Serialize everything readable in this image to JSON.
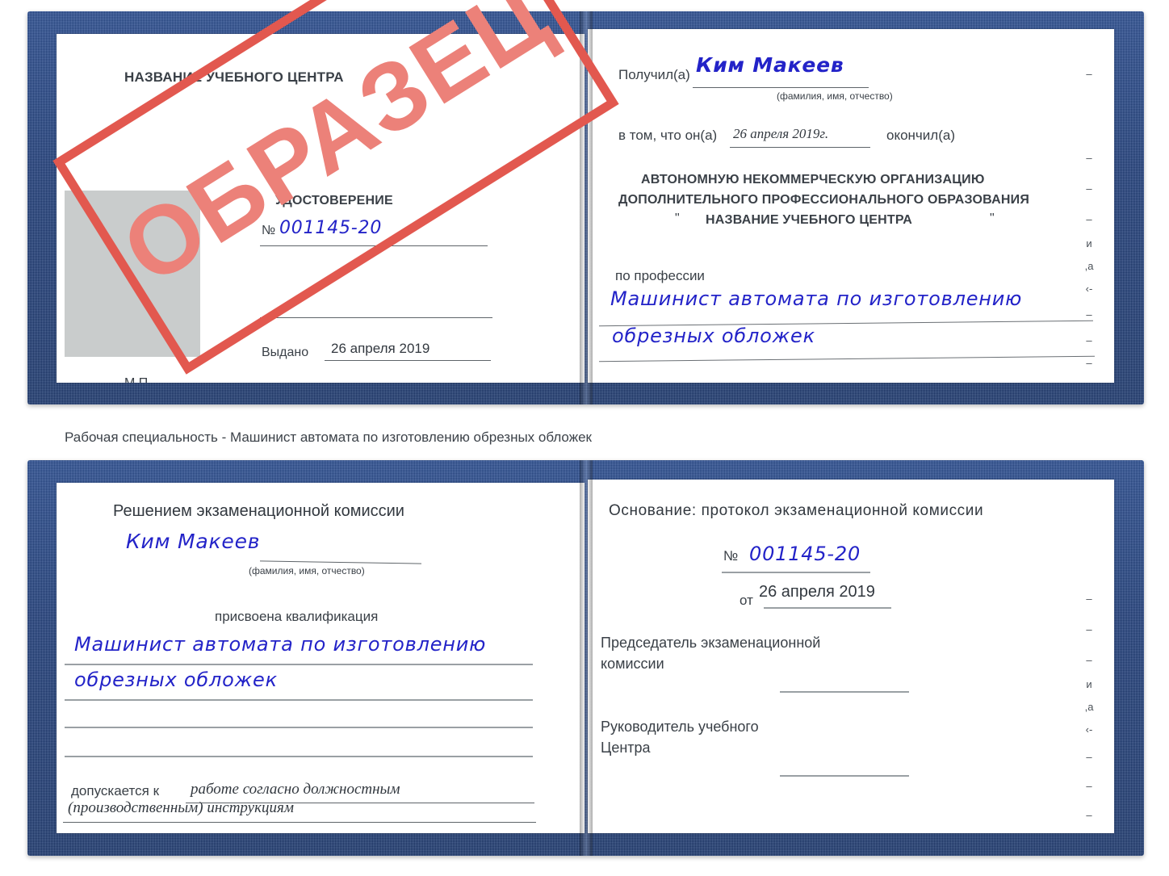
{
  "caption": "Рабочая специальность - Машинист автомата по изготовлению обрезных обложек",
  "stamp": {
    "text": "ОБРАЗЕЦ",
    "color": "#e2584f"
  },
  "colors": {
    "cover_blue": "#21407e",
    "handwriting_blue": "#2323c8",
    "stamp_red": "#e2584f",
    "photo_gray": "#c9cccc",
    "page_white": "#ffffff",
    "rule_gray": "#6a6f74"
  },
  "doc_top": {
    "left_page": {
      "center_name": "НАЗВАНИЕ УЧЕБНОГО ЦЕНТРА",
      "title": "УДОСТОВЕРЕНИЕ",
      "number_label": "№",
      "number_value": "001145-20",
      "issued_label": "Выдано",
      "issued_value": "26 апреля 2019",
      "seal_label": "М.П.",
      "photo_placeholder": ""
    },
    "right_page": {
      "received_label": "Получил(а)",
      "received_value": "Ким Макеев",
      "fio_hint": "(фамилия, имя, отчество)",
      "that_he_label": "в том, что он(а)",
      "that_he_value": "26 апреля 2019г.",
      "finished_label": "окончил(а)",
      "org_line1": "АВТОНОМНУЮ НЕКОММЕРЧЕСКУЮ ОРГАНИЗАЦИЮ",
      "org_line2": "ДОПОЛНИТЕЛЬНОГО ПРОФЕССИОНАЛЬНОГО ОБРАЗОВАНИЯ",
      "org_quote_open": "\"",
      "org_line3": "НАЗВАНИЕ УЧЕБНОГО ЦЕНТРА",
      "org_quote_close": "\"",
      "profession_label": "по профессии",
      "profession_line1": "Машинист автомата по изготовлению",
      "profession_line2": "обрезных обложек",
      "edge_fragments": [
        "–",
        "–",
        "–",
        "–",
        "и",
        "а",
        "‹-",
        "–",
        "–",
        "–",
        "–"
      ]
    }
  },
  "doc_bottom": {
    "left_page": {
      "decision_title": "Решением экзаменационной комиссии",
      "name_value": "Ким Макеев",
      "fio_hint": "(фамилия, имя, отчество)",
      "qualification_label": "присвоена квалификация",
      "qualification_line1": "Машинист автомата по изготовлению",
      "qualification_line2": "обрезных обложек",
      "admitted_label": "допускается к",
      "admitted_value_line1": "работе согласно должностным",
      "admitted_value_line2": "(производственным) инструкциям"
    },
    "right_page": {
      "basis_label": "Основание: протокол экзаменационной комиссии",
      "number_label": "№",
      "number_value": "001145-20",
      "date_label": "от",
      "date_value": "26 апреля 2019",
      "chairman_line1": "Председатель экзаменационной",
      "chairman_line2": "комиссии",
      "head_line1": "Руководитель учебного",
      "head_line2": "Центра",
      "edge_fragments": [
        "–",
        "–",
        "–",
        "и",
        "а",
        "‹-",
        "–",
        "–",
        "–"
      ]
    }
  }
}
